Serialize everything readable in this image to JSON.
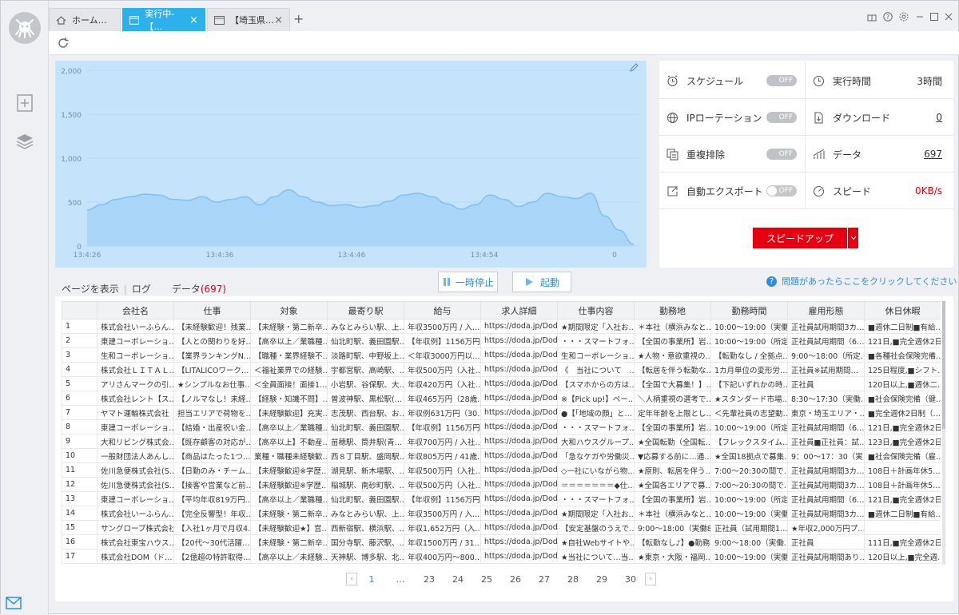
{
  "tabs": [
    {
      "label": "ホーム…",
      "icon": "home-icon"
    },
    {
      "label": "実行中-【…",
      "icon": "page-icon"
    },
    {
      "label": "【埼玉県…",
      "icon": "page-icon"
    }
  ],
  "window_controls": [
    "gift-icon",
    "help-icon",
    "settings-icon",
    "minimize-icon",
    "maximize-icon",
    "close-icon"
  ],
  "chart_data": {
    "type": "area",
    "x_ticks": [
      "13:4:26",
      "13:4:36",
      "13:4:46",
      "13:4:54",
      "0"
    ],
    "y_ticks": [
      "2,000",
      "1,500",
      "1,000",
      "500",
      "0"
    ],
    "ylim": [
      0,
      2000
    ],
    "values": [
      410,
      470,
      530,
      560,
      590,
      580,
      530,
      520,
      560,
      500,
      530,
      560,
      470,
      560,
      640,
      560,
      500,
      460,
      470,
      440,
      460,
      510,
      580,
      600,
      560,
      480,
      420,
      470,
      580,
      530,
      450,
      500,
      600,
      560,
      540,
      600,
      340,
      180,
      20
    ],
    "fill_color": "#a9d6f8",
    "line_color": "#7ec0f0"
  },
  "stats": {
    "schedule": {
      "label": "スケジュール",
      "toggle": "OFF"
    },
    "run_time": {
      "label": "実行時間",
      "value": "3時間"
    },
    "ip_rotation": {
      "label": "IPローテーション",
      "toggle": "OFF"
    },
    "download": {
      "label": "ダウンロード",
      "value": "0"
    },
    "dedupe": {
      "label": "重複排除",
      "toggle": "OFF"
    },
    "data": {
      "label": "データ",
      "value": "697"
    },
    "auto_export": {
      "label": "自動エクスポート",
      "toggle": "OFF"
    },
    "speed": {
      "label": "スピード",
      "value": "0KB/s"
    }
  },
  "speedup_label": "スピードアップ",
  "subtabs": {
    "page": "ページを表示",
    "log": "ログ",
    "data": "データ",
    "data_count": "(697)"
  },
  "pause_label": "一時停止",
  "start_label": "起動",
  "help_text": "問題があったらここをクリックしてください",
  "table": {
    "headers": [
      "",
      "会社名",
      "仕事",
      "対象",
      "最寄り駅",
      "給与",
      "求人詳細",
      "仕事内容",
      "勤務地",
      "勤務時間",
      "雇用形態",
      "休日休暇"
    ],
    "rows": [
      [
        "1",
        "株式会社いーふらん…",
        "【未経験歓迎！残業…",
        "【未経験・第二新卒…",
        "みなとみらい駅、上…",
        "年収3500万円 / 入…",
        "https://doda.jp/Doda…",
        "★期間限定「入社お…",
        "＊本社（横浜みなと…",
        "10:00～19:00（実働…",
        "正社員試用期間3カ…",
        "■週休二日制■有給…"
      ],
      [
        "2",
        "東建コーポレーショ…",
        "【人との関わりを好…",
        "【高卒以上／業職種…",
        "仙北町駅、義田園駅…",
        "【年収例】1156万円…",
        "https://doda.jp/Doda…",
        "・・・スマートフォ…",
        "【全国の事業所】岩…",
        "10:00～19:00（所定…",
        "正社員試用期間（6…",
        "121日,■完全週休2日…"
      ],
      [
        "3",
        "生和コーポレーショ…",
        "【業界ランキングN…",
        "【職種・業界経験不…",
        "淡路町駅、中野坂上…",
        "＜年収3000万円以…",
        "https://doda.jp/Doda…",
        "生和コーポレーショ…",
        "★人物・意欲重視の…",
        "【転勤なし / 全拠点…",
        "9:00～18:00（所定…",
        "■各種社会保険完備…"
      ],
      [
        "4",
        "株式会社ＬＩＴＡＬ…",
        "【LITALICOワーク…",
        "＜福祉業界での経験…",
        "宇都宮駅、高崎駅、…",
        "年収500万円（入社…",
        "https://doda.jp/Doda…",
        "《　当社について　…",
        "【転居を伴う転勤な…",
        "1カ月単位の変形労…",
        "正社員※試用期間…",
        "125日程度,■シフト…"
      ],
      [
        "5",
        "アリさんマークの引…",
        "★シンプルなお仕事…",
        "＜全員面接！面接1…",
        "小岩駅、谷保駅、大…",
        "年収420万円（入社…",
        "https://doda.jp/Doda…",
        "【スマホからの方は…",
        "【全国で大募集！】…",
        "【下記いずれかの時…",
        "正社員",
        "120日以上,■週休二…"
      ],
      [
        "6",
        "株式会社レント【ス…",
        "【ノルマなし！未経…",
        "【経験・知識不問】…",
        "曽波神駅、黒松駅(…",
        "年収465万円（28歳…",
        "https://doda.jp/Doda…",
        "※【Pick up!】ペー…",
        "＼人柄重視の選考で…",
        "★スタンダード市場…",
        "8:30～17:30（実働…",
        "■社会保険完備（健…"
      ],
      [
        "7",
        "ヤマト運輸株式会社",
        "担当エリアで荷物を…",
        "【未経験歓迎】充実…",
        "志茂駅、西台駅、お…",
        "年収例631万円（30…",
        "https://doda.jp/Doda…",
        "●【「地域の顔」と…",
        "定年年齢を上限とし…",
        "＜先輩社員の志望動…",
        "東京・埼玉エリア・…",
        "■完全週休2日制（…"
      ],
      [
        "8",
        "東建コーポレーショ…",
        "【結婚・出産祝い金…",
        "【高卒以上／業職種…",
        "仙北町駅、義田園駅…",
        "【年収例】1156万円…",
        "https://doda.jp/Doda…",
        "・・・スマートフォ…",
        "【全国の事業所】岩…",
        "10:00～19:00（所定…",
        "正社員試用期間（6…",
        "121日,■完全週休2日…"
      ],
      [
        "9",
        "大和リビング株式会…",
        "【既存顧客の対応が…",
        "【高卒以上】不動産…",
        "苗穂駅、筒井駅(青…",
        "年収700万円 / 入社…",
        "https://doda.jp/Doda…",
        "大和ハウスグループ…",
        "★全国転勤（全国転…",
        "【フレックスタイム…",
        "正社員■正社員：試…",
        "123日,■完全週休2日…"
      ],
      [
        "10",
        "一般財団法人あんし…",
        "【商品はたった1つ…",
        "業種・職種未経験歓…",
        "西８丁目駅、盛岡駅…",
        "年収805万円 / 41歳…",
        "https://doda.jp/Doda…",
        "「急なケガや労働災…",
        "▼応募する前に…通…",
        "★全国18拠点で募集…",
        "9：00～17：30（実…",
        "■社会保険完備（雇…"
      ],
      [
        "11",
        "佐川急便株式会社(S…",
        "【日勤のみ・チーム…",
        "【未経験歓迎※学歴…",
        "湖見駅、新木場駅、…",
        "年収500万円（入社…",
        "https://doda.jp/Doda…",
        "◇一社にいながら物…",
        "★原則、転居を伴う…",
        "7:00～20:30の間で…",
        "正社員試用期間3カ…",
        "108日＋計画年休5…"
      ],
      [
        "12",
        "佐川急便株式会社(S…",
        "【接客や営業など前…",
        "【未経験歓迎※学歴…",
        "稲城駅、南砂町駅、…",
        "年収500万円（入社…",
        "https://doda.jp/Doda…",
        "＝＝＝＝＝＝＝◆仕…",
        "★全国各エリアで募…",
        "7:00～20:30の間で…",
        "正社員試用期間3カ…",
        "108日＋計画年休5…"
      ],
      [
        "13",
        "東建コーポレーショ…",
        "【平均年収819万円…",
        "【高卒以上／業職種…",
        "仙北町駅、義田園駅…",
        "【年収例】1156万円…",
        "https://doda.jp/Doda…",
        "・・・スマートフォ…",
        "【全国の事業所】岩…",
        "10:00～19:00（所定…",
        "正社員試用期間（6…",
        "121日,■完全週休2日…"
      ],
      [
        "14",
        "株式会社いーふらん…",
        "【完全反響型！年収…",
        "【未経験・第二新卒…",
        "みなとみらい駅、上…",
        "年収3500万円 / 入…",
        "https://doda.jp/Doda…",
        "★期間限定「入社お…",
        "＊本社（横浜みなと…",
        "10:00～19:00（実働…",
        "正社員試用期間3カ…",
        "■週休二日制■有給…"
      ],
      [
        "15",
        "サングローブ株式会社",
        "【入社1ヶ月で月収4…",
        "【未経験歓迎★】営…",
        "西新宿駅、横浜駅、…",
        "年収1,652万円（入…",
        "https://doda.jp/Doda…",
        "【安定基盤のうえで…",
        "9:00～18:00（実働8…",
        "正社員（試用期間1…",
        "★年収2,000万円プ…",
        ""
      ],
      [
        "16",
        "株式会社東宝ハウス…",
        "【20代～30代活躍…",
        "【未経験・第二新卒…",
        "国分寺駅、藤沢駅、…",
        "年収1500万円 / 31…",
        "https://doda.jp/Doda…",
        "★自社Webサイトや…",
        "【転勤なし♪】●勤務…",
        "9:00～18:00（実働…",
        "正社員",
        "111日,■完全週休2日…"
      ],
      [
        "17",
        "株式会社DOM（ド…",
        "【2億超の特許取得…",
        "【高卒以上／未経験…",
        "天神駅、博多駅、北…",
        "年収400万円～800…",
        "https://doda.jp/Doda…",
        "★当社について…当…",
        "★東京・大阪・福岡…",
        "10:00～19:00（実働…",
        "正社員試用期間あり…",
        "120日以上,■完全週…"
      ]
    ]
  },
  "pager": {
    "prev": "‹",
    "pages": [
      "1",
      "…",
      "23",
      "24",
      "25",
      "26",
      "27",
      "28",
      "29",
      "30"
    ],
    "next": "›"
  }
}
